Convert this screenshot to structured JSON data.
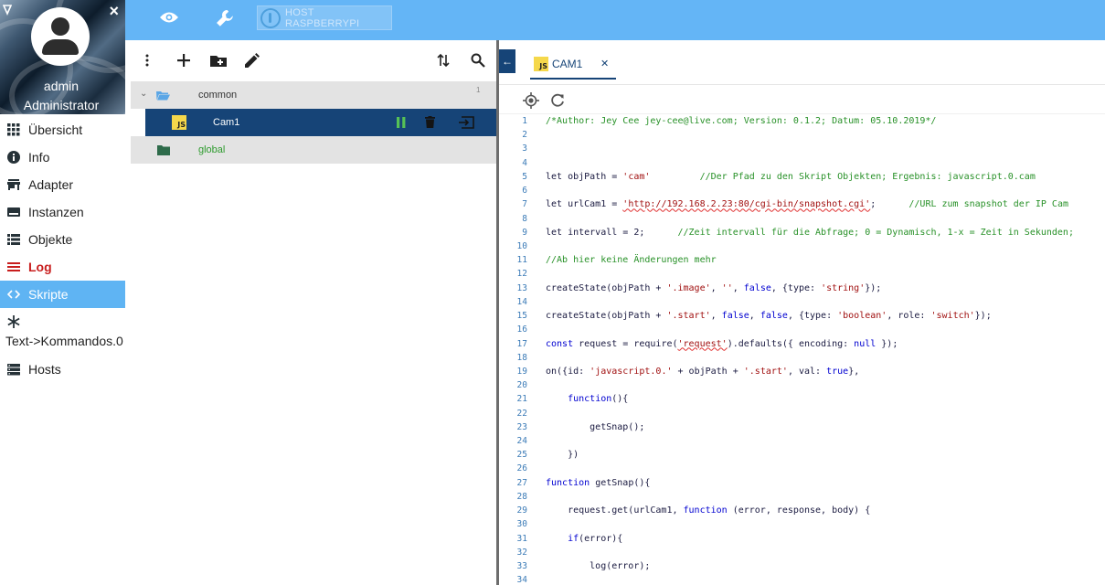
{
  "sidebar": {
    "user_name": "admin",
    "user_role": "Administrator",
    "items": [
      {
        "label": "Übersicht",
        "icon": "grid-icon"
      },
      {
        "label": "Info",
        "icon": "info-icon"
      },
      {
        "label": "Adapter",
        "icon": "store-icon"
      },
      {
        "label": "Instanzen",
        "icon": "instances-icon"
      },
      {
        "label": "Objekte",
        "icon": "list-icon"
      },
      {
        "label": "Log",
        "icon": "log-icon"
      },
      {
        "label": "Skripte",
        "icon": "code-icon"
      },
      {
        "label": "Text->Kommandos.0",
        "icon": "snowflake-icon"
      },
      {
        "label": "Hosts",
        "icon": "hosts-icon"
      }
    ],
    "active_item": "Skripte"
  },
  "topbar": {
    "host_label": "HOST RASPBERRYPI"
  },
  "tree": {
    "folders": [
      {
        "name": "common",
        "count": "1",
        "scripts": [
          {
            "name": "Cam1",
            "type": "JS"
          }
        ]
      },
      {
        "name": "global",
        "count": "",
        "scripts": []
      }
    ]
  },
  "editor": {
    "tab_label": "CAM1",
    "tab_type": "JS",
    "code_lines": [
      [
        {
          "t": "/*Author: Jey Cee jey-cee@live.com; Version: 0.1.2; Datum: 05.10.2019*/",
          "c": "t-comment"
        }
      ],
      [],
      [],
      [],
      [
        {
          "t": "let objPath = "
        },
        {
          "t": "'cam'",
          "c": "t-string"
        },
        {
          "t": "         "
        },
        {
          "t": "//Der Pfad zu den Skript Objekten; Ergebnis: javascript.0.cam",
          "c": "t-comment"
        }
      ],
      [],
      [
        {
          "t": "let urlCam1 = "
        },
        {
          "t": "'http://192.168.2.23:80/cgi-bin/snapshot.cgi'",
          "c": "t-string t-squiggle"
        },
        {
          "t": ";      "
        },
        {
          "t": "//URL zum snapshot der IP Cam",
          "c": "t-comment"
        }
      ],
      [],
      [
        {
          "t": "let intervall = 2;      "
        },
        {
          "t": "//Zeit intervall für die Abfrage; 0 = Dynamisch, 1-x = Zeit in Sekunden;",
          "c": "t-comment"
        }
      ],
      [],
      [
        {
          "t": "//Ab hier keine Änderungen mehr",
          "c": "t-comment"
        }
      ],
      [],
      [
        {
          "t": "createState(objPath + "
        },
        {
          "t": "'.image'",
          "c": "t-string"
        },
        {
          "t": ", "
        },
        {
          "t": "''",
          "c": "t-string"
        },
        {
          "t": ", "
        },
        {
          "t": "false",
          "c": "t-keyword"
        },
        {
          "t": ", {type: "
        },
        {
          "t": "'string'",
          "c": "t-string"
        },
        {
          "t": "});"
        }
      ],
      [],
      [
        {
          "t": "createState(objPath + "
        },
        {
          "t": "'.start'",
          "c": "t-string"
        },
        {
          "t": ", "
        },
        {
          "t": "false",
          "c": "t-keyword"
        },
        {
          "t": ", "
        },
        {
          "t": "false",
          "c": "t-keyword"
        },
        {
          "t": ", {type: "
        },
        {
          "t": "'boolean'",
          "c": "t-string"
        },
        {
          "t": ", role: "
        },
        {
          "t": "'switch'",
          "c": "t-string"
        },
        {
          "t": "});"
        }
      ],
      [],
      [
        {
          "t": "const",
          "c": "t-keyword"
        },
        {
          "t": " request = require("
        },
        {
          "t": "'request'",
          "c": "t-string t-squiggle"
        },
        {
          "t": ").defaults({ encoding: "
        },
        {
          "t": "null",
          "c": "t-keyword"
        },
        {
          "t": " });"
        }
      ],
      [],
      [
        {
          "t": "on({id: "
        },
        {
          "t": "'javascript.0.'",
          "c": "t-string"
        },
        {
          "t": " + objPath + "
        },
        {
          "t": "'.start'",
          "c": "t-string"
        },
        {
          "t": ", val: "
        },
        {
          "t": "true",
          "c": "t-keyword"
        },
        {
          "t": "},"
        }
      ],
      [],
      [
        {
          "t": "    "
        },
        {
          "t": "function",
          "c": "t-keyword"
        },
        {
          "t": "(){"
        }
      ],
      [],
      [
        {
          "t": "        getSnap();"
        }
      ],
      [],
      [
        {
          "t": "    })"
        }
      ],
      [],
      [
        {
          "t": "function",
          "c": "t-keyword"
        },
        {
          "t": " getSnap(){"
        }
      ],
      [],
      [
        {
          "t": "    request.get(urlCam1, "
        },
        {
          "t": "function",
          "c": "t-keyword"
        },
        {
          "t": " (error, response, body) {"
        }
      ],
      [],
      [
        {
          "t": "    "
        },
        {
          "t": "if",
          "c": "t-keyword"
        },
        {
          "t": "(error){"
        }
      ],
      [],
      [
        {
          "t": "        log(error);"
        }
      ],
      []
    ]
  }
}
